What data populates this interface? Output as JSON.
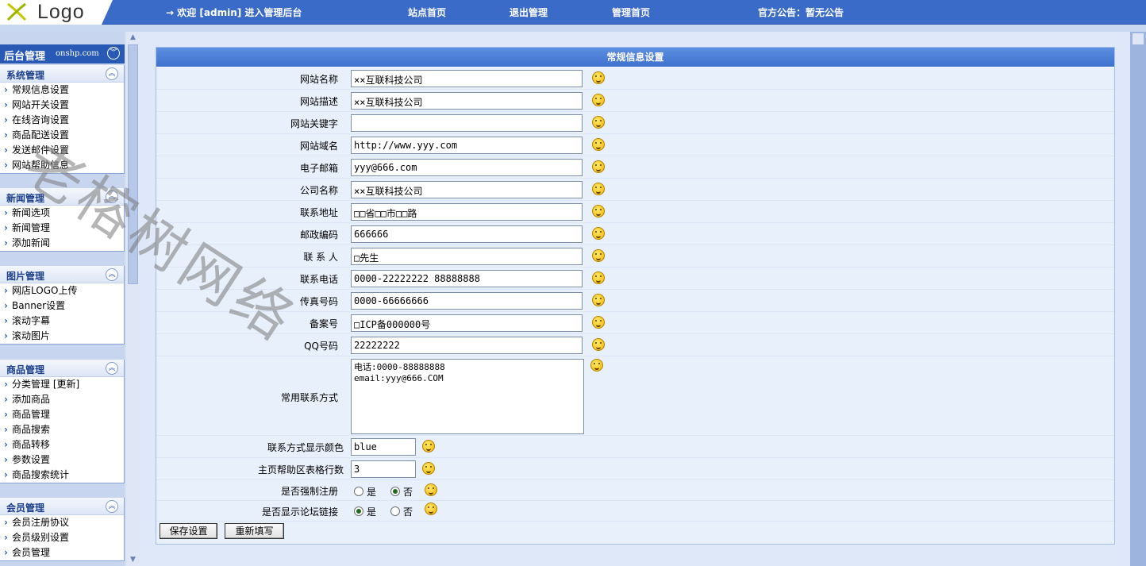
{
  "header": {
    "logo_text": "Logo",
    "welcome": "→ 欢迎 [admin] 进入管理后台",
    "links": [
      "站点首页",
      "退出管理",
      "管理首页"
    ],
    "notice": "官方公告：暂无公告"
  },
  "sidebar": {
    "title": "后台管理",
    "domain": "onshp.com",
    "collapse_icon": "chevron-double-down-icon",
    "menus": [
      {
        "title": "系统管理",
        "items": [
          "常规信息设置",
          "网站开关设置",
          "在线咨询设置",
          "商品配送设置",
          "发送邮件设置",
          "网站帮助信息"
        ]
      },
      {
        "title": "新闻管理",
        "items": [
          "新闻选项",
          "新闻管理",
          "添加新闻"
        ]
      },
      {
        "title": "图片管理",
        "items": [
          "网店LOGO上传",
          "Banner设置",
          "滚动字幕",
          "滚动图片"
        ]
      },
      {
        "title": "商品管理",
        "items": [
          "分类管理 [更新]",
          "添加商品",
          "商品管理",
          "商品搜索",
          "商品转移",
          "参数设置",
          "商品搜索统计"
        ]
      },
      {
        "title": "会员管理",
        "items": [
          "会员注册协议",
          "会员级别设置",
          "会员管理"
        ]
      }
    ]
  },
  "form": {
    "title": "常规信息设置",
    "fields": [
      {
        "label": "网站名称",
        "value": "××互联科技公司"
      },
      {
        "label": "网站描述",
        "value": "××互联科技公司"
      },
      {
        "label": "网站关键字",
        "value": ""
      },
      {
        "label": "网站域名",
        "value": "http://www.yyy.com"
      },
      {
        "label": "电子邮箱",
        "value": "yyy@666.com"
      },
      {
        "label": "公司名称",
        "value": "××互联科技公司"
      },
      {
        "label": "联系地址",
        "value": "□□省□□市□□路"
      },
      {
        "label": "邮政编码",
        "value": "666666"
      },
      {
        "label": "联 系 人",
        "value": "□先生"
      },
      {
        "label": "联系电话",
        "value": "0000-22222222 88888888"
      },
      {
        "label": "传真号码",
        "value": "0000-66666666"
      },
      {
        "label": "备案号",
        "value": "□ICP备000000号"
      },
      {
        "label": "QQ号码",
        "value": "22222222"
      }
    ],
    "contact": {
      "label": "常用联系方式",
      "value": "电话:0000-88888888\nemail:yyy@666.COM"
    },
    "color": {
      "label": "联系方式显示颜色",
      "value": "blue"
    },
    "help_rows": {
      "label": "主页帮助区表格行数",
      "value": "3"
    },
    "force_register": {
      "label": "是否强制注册",
      "yes": "是",
      "no": "否",
      "selected": "no"
    },
    "forum_link": {
      "label": "是否显示论坛链接",
      "yes": "是",
      "no": "否",
      "selected": "yes"
    },
    "save_button": "保存设置",
    "reset_button": "重新填写"
  },
  "watermark": "老榕树网络",
  "colors": {
    "topbar": "#3a6bc9",
    "panel_title": "#4a7dd6",
    "sidebar_head": "#2859b5"
  }
}
